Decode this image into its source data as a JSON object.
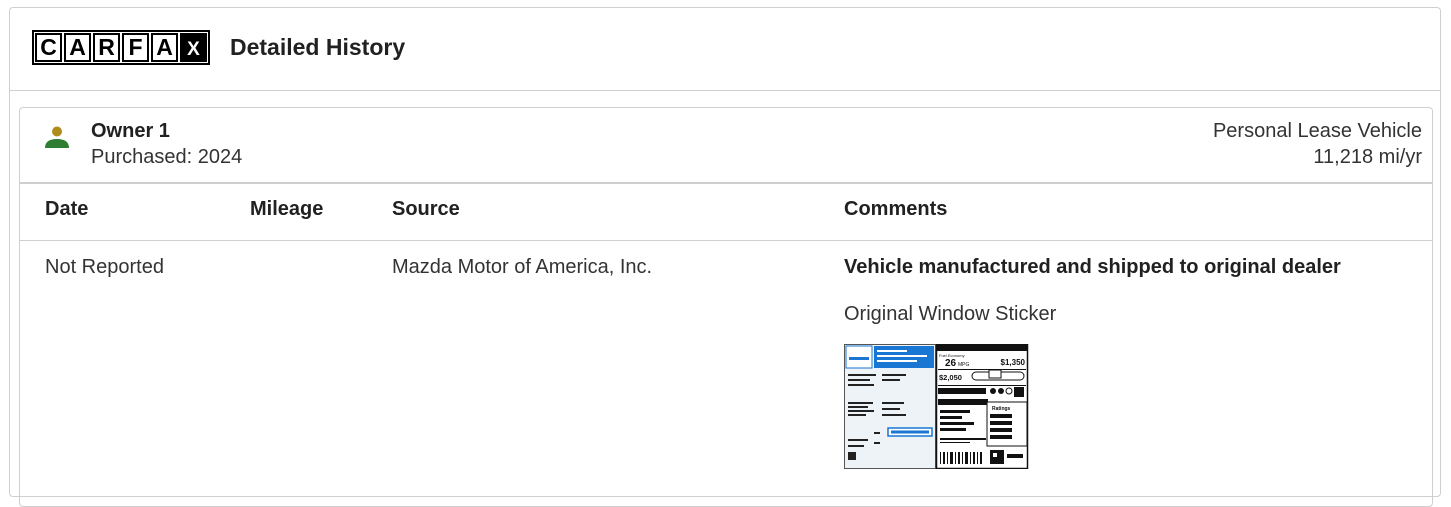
{
  "header": {
    "logo_letters": [
      "C",
      "A",
      "R",
      "F",
      "A",
      "X"
    ],
    "title": "Detailed History"
  },
  "owner": {
    "name": "Owner 1",
    "purchased": "Purchased: 2024",
    "type": "Personal Lease Vehicle",
    "miles_per_year": "11,218 mi/yr",
    "icon_colors": {
      "head": "#b08d1a",
      "body": "#2e7d32"
    }
  },
  "table": {
    "columns": [
      "Date",
      "Mileage",
      "Source",
      "Comments"
    ],
    "rows": [
      {
        "date": "Not Reported",
        "mileage": "",
        "source": "Mazda Motor of America, Inc.",
        "comment_title": "Vehicle manufactured and shipped to original dealer",
        "comment_detail": "Original Window Sticker"
      }
    ]
  },
  "sticker": {
    "mpg": "26",
    "mpg_unit": "MPG",
    "save": "$1,350",
    "fuel_cost": "$2,050",
    "ratings_label": "Ratings",
    "accent_color": "#1976d2"
  }
}
